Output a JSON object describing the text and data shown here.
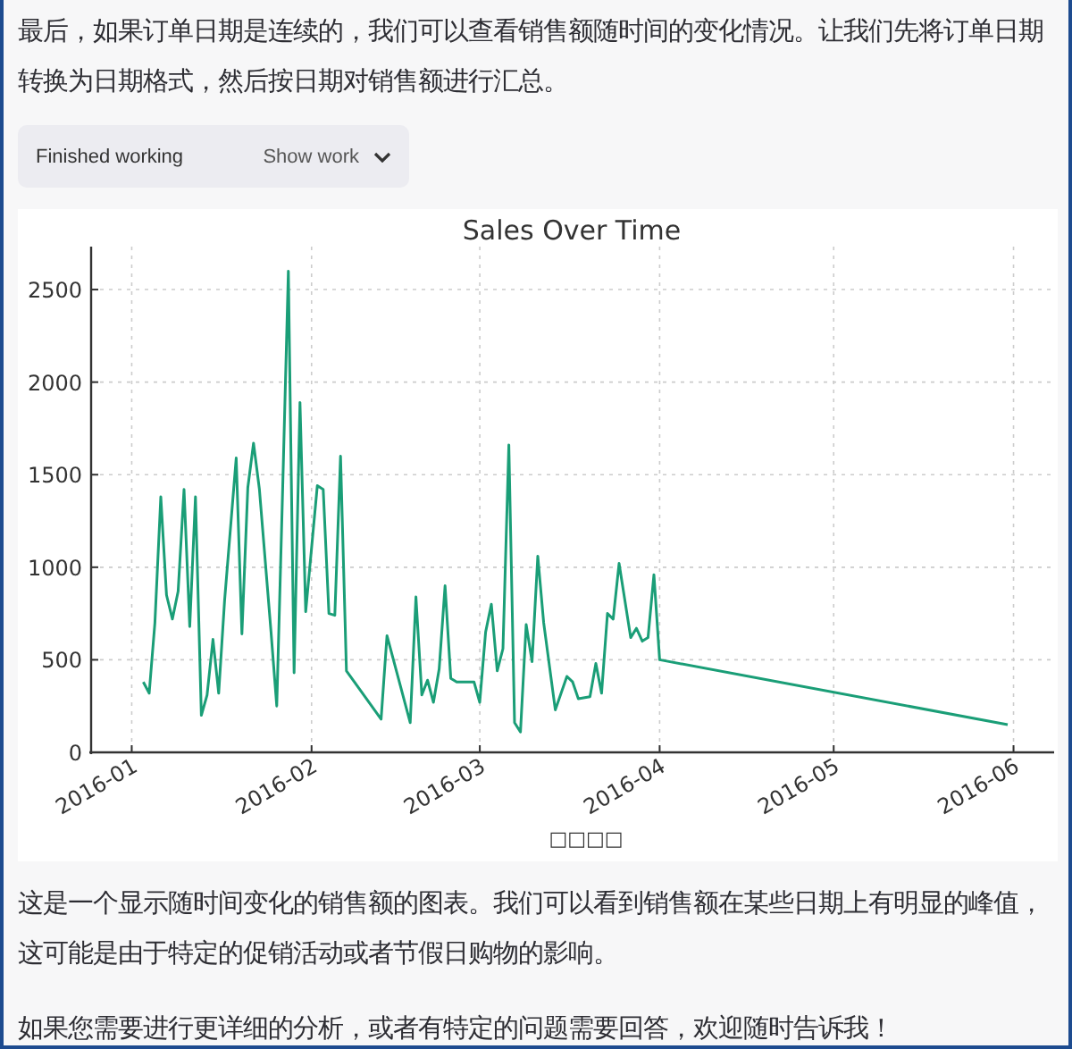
{
  "intro": "最后，如果订单日期是连续的，我们可以查看销售额随时间的变化情况。让我们先将订单日期转换为日期格式，然后按日期对销售额进行汇总。",
  "work": {
    "status": "Finished working",
    "toggle": "Show work",
    "expanded": false
  },
  "chart_data": {
    "type": "line",
    "title": "Sales Over Time",
    "xlabel": "□□□□",
    "xticks": [
      {
        "value": "2016-01-01",
        "label": "2016-01"
      },
      {
        "value": "2016-02-01",
        "label": "2016-02"
      },
      {
        "value": "2016-03-01",
        "label": "2016-03"
      },
      {
        "value": "2016-04-01",
        "label": "2016-04"
      },
      {
        "value": "2016-05-01",
        "label": "2016-05"
      },
      {
        "value": "2016-06-01",
        "label": "2016-06"
      }
    ],
    "yticks": [
      0,
      500,
      1000,
      1500,
      2000,
      2500
    ],
    "ylim": [
      0,
      2732
    ],
    "xlim": [
      "2015-12-25",
      "2016-06-08"
    ],
    "grid": true,
    "x": [
      "2016-01-03",
      "2016-01-04",
      "2016-01-05",
      "2016-01-06",
      "2016-01-07",
      "2016-01-08",
      "2016-01-09",
      "2016-01-10",
      "2016-01-11",
      "2016-01-12",
      "2016-01-13",
      "2016-01-14",
      "2016-01-15",
      "2016-01-16",
      "2016-01-17",
      "2016-01-19",
      "2016-01-20",
      "2016-01-21",
      "2016-01-22",
      "2016-01-23",
      "2016-01-25",
      "2016-01-26",
      "2016-01-27",
      "2016-01-28",
      "2016-01-29",
      "2016-01-30",
      "2016-01-31",
      "2016-02-02",
      "2016-02-03",
      "2016-02-04",
      "2016-02-05",
      "2016-02-06",
      "2016-02-07",
      "2016-02-13",
      "2016-02-14",
      "2016-02-18",
      "2016-02-19",
      "2016-02-20",
      "2016-02-21",
      "2016-02-22",
      "2016-02-23",
      "2016-02-24",
      "2016-02-25",
      "2016-02-26",
      "2016-02-29",
      "2016-03-01",
      "2016-03-02",
      "2016-03-03",
      "2016-03-04",
      "2016-03-05",
      "2016-03-06",
      "2016-03-07",
      "2016-03-08",
      "2016-03-09",
      "2016-03-10",
      "2016-03-11",
      "2016-03-12",
      "2016-03-14",
      "2016-03-16",
      "2016-03-17",
      "2016-03-18",
      "2016-03-20",
      "2016-03-21",
      "2016-03-22",
      "2016-03-23",
      "2016-03-24",
      "2016-03-25",
      "2016-03-27",
      "2016-03-28",
      "2016-03-29",
      "2016-03-30",
      "2016-03-31",
      "2016-04-01",
      "2016-05-31"
    ],
    "series": [
      {
        "color": "#1a9e77",
        "values": [
          380,
          320,
          700,
          1380,
          850,
          720,
          870,
          1420,
          680,
          1380,
          200,
          310,
          610,
          320,
          820,
          1590,
          640,
          1430,
          1670,
          1420,
          650,
          250,
          1420,
          2600,
          430,
          1890,
          760,
          1440,
          1420,
          750,
          740,
          1600,
          440,
          180,
          630,
          160,
          840,
          310,
          390,
          270,
          450,
          900,
          400,
          380,
          380,
          270,
          650,
          800,
          440,
          560,
          1660,
          160,
          110,
          690,
          490,
          1060,
          700,
          230,
          410,
          380,
          290,
          300,
          480,
          320,
          750,
          720,
          1020,
          620,
          670,
          600,
          620,
          960,
          500,
          150
        ]
      }
    ]
  },
  "summary": "这是一个显示随时间变化的销售额的图表。我们可以看到销售额在某些日期上有明显的峰值，这可能是由于特定的促销活动或者节假日购物的影响。",
  "closing": "如果您需要进行更详细的分析，或者有特定的问题需要回答，欢迎随时告诉我！"
}
